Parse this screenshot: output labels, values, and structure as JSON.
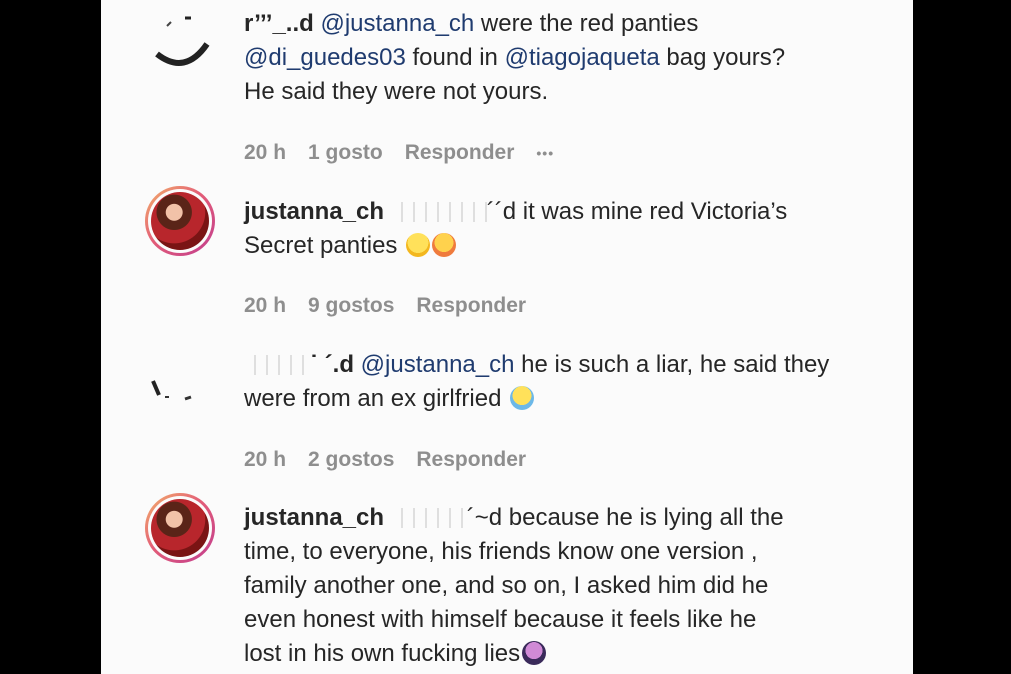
{
  "comments": [
    {
      "username": "r’’’_..d",
      "prefix": "",
      "mention1": "@justanna_ch",
      "text1": " were the red panties",
      "mention2": "@di_guedes03",
      "text2": " found in ",
      "mention3": "@tiagojaqueta",
      "text3": " bag yours?",
      "text4": "He said they were not yours.",
      "time": "20 h",
      "likes": "1 gosto",
      "reply": "Responder",
      "more": "•••"
    },
    {
      "username": "justanna_ch",
      "redacted_suffix": "´´d",
      "text1": " it was mine red Victoria’s",
      "text2": "Secret panties ",
      "emoji1": "grinning-face",
      "emoji2": "smiling-face-with-hearts",
      "time": "20 h",
      "likes": "9 gostos",
      "reply": "Responder"
    },
    {
      "username": "˙ ´.d",
      "mention1": "@justanna_ch",
      "text1": " he is such a liar, he said they",
      "text2": "were from an ex girlfried ",
      "emoji1": "face-with-tears-of-joy",
      "time": "20 h",
      "likes": "2 gostos",
      "reply": "Responder"
    },
    {
      "username": "justanna_ch",
      "redacted_suffix": "´~d",
      "text1": " because he is lying all the",
      "line2": "time, to everyone, his friends know one version ,",
      "line3": "family another one, and so on, I asked him did he",
      "line4": "even honest with himself because it feels like he",
      "line5": "lost in his own fucking lies",
      "emoji1": "person-facepalming"
    }
  ],
  "colors": {
    "text": "#262626",
    "meta": "#8e8e8e",
    "mention": "#1f3b6f",
    "background": "#fbfbfb",
    "frame": "#000000"
  }
}
